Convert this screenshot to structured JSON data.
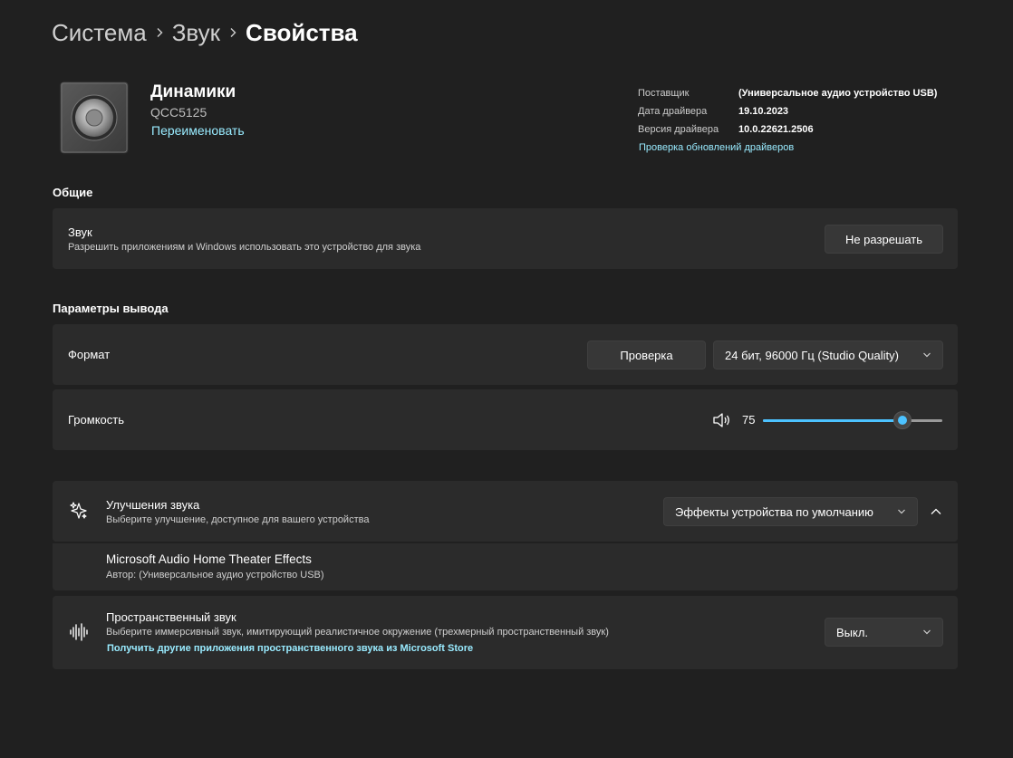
{
  "breadcrumb": {
    "item1": "Система",
    "item2": "Звук",
    "current": "Свойства"
  },
  "device": {
    "name": "Динамики",
    "model": "QCC5125",
    "rename_link": "Переименовать",
    "icon": "speaker-icon"
  },
  "driver_info": {
    "provider_label": "Поставщик",
    "provider_value": "(Универсальное аудио устройство USB)",
    "date_label": "Дата драйвера",
    "date_value": "19.10.2023",
    "version_label": "Версия драйвера",
    "version_value": "10.0.22621.2506",
    "update_link": "Проверка обновлений драйверов"
  },
  "general": {
    "section_title": "Общие",
    "sound_title": "Звук",
    "sound_subtitle": "Разрешить приложениям и Windows использовать это устройство для звука",
    "disallow_button": "Не разрешать"
  },
  "output": {
    "section_title": "Параметры вывода",
    "format_label": "Формат",
    "test_button": "Проверка",
    "format_value": "24 бит, 96000 Гц (Studio Quality)",
    "volume_label": "Громкость",
    "volume_value": "75",
    "volume_level": 75
  },
  "enhancements": {
    "title": "Улучшения звука",
    "subtitle": "Выберите улучшение, доступное для вашего устройства",
    "selected": "Эффекты устройства по умолчанию",
    "effect_name": "Microsoft Audio Home Theater Effects",
    "effect_author": "Автор: (Универсальное аудио устройство USB)"
  },
  "spatial": {
    "title": "Пространственный звук",
    "subtitle": "Выберите иммерсивный звук, имитирующий реалистичное окружение (трехмерный пространственный звук)",
    "store_link": "Получить другие приложения пространственного звука из Microsoft Store",
    "selected": "Выкл."
  },
  "colors": {
    "accent": "#4cc2ff",
    "link": "#99ebff",
    "background": "#202020",
    "card": "#2b2b2b"
  }
}
